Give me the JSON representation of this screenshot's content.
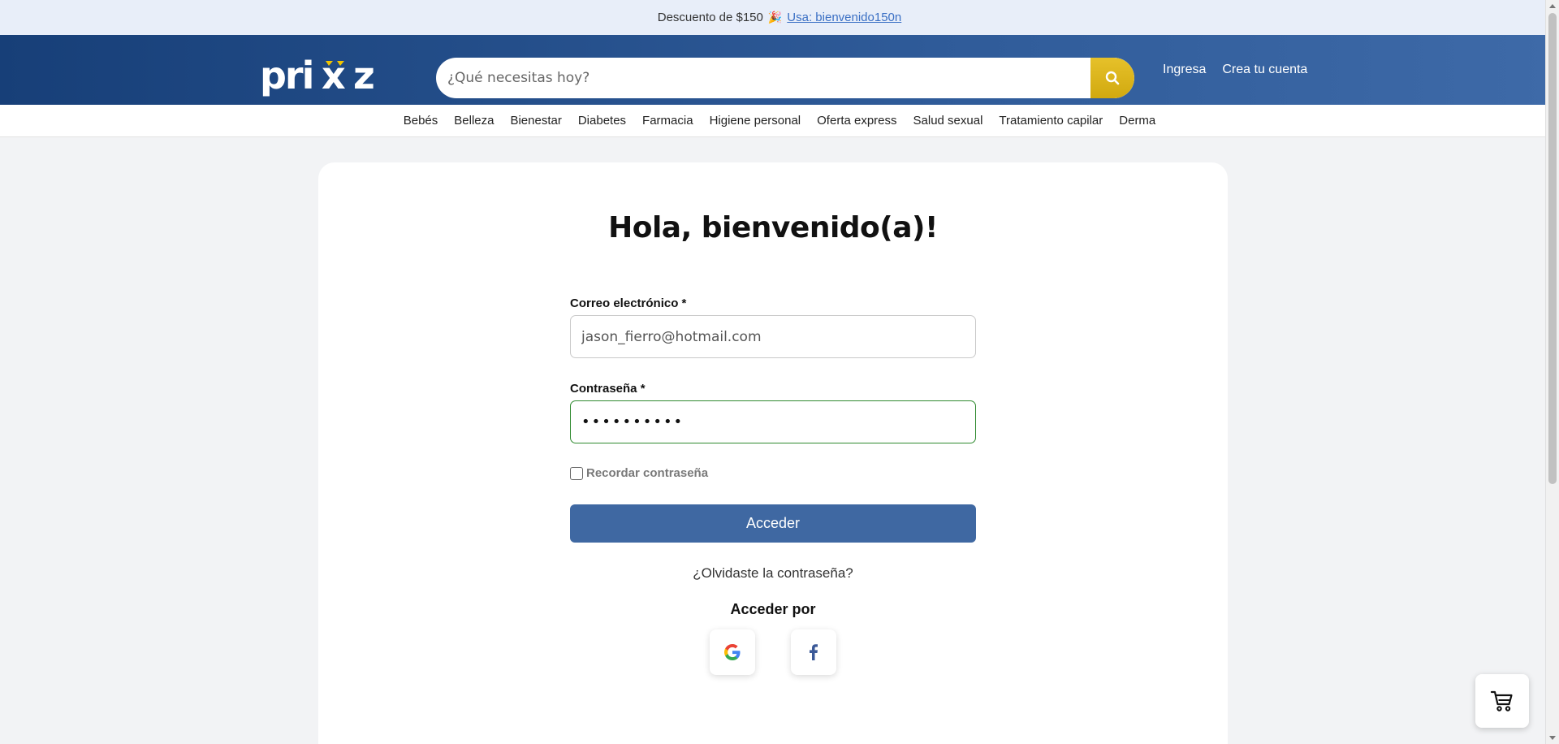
{
  "promo": {
    "text": "Descuento de $150",
    "confetti_icon": "party-popper-icon",
    "code_link": "Usa: bienvenido150n"
  },
  "header": {
    "logo_text": "prixz",
    "search_placeholder": "¿Qué necesitas hoy?",
    "login_link": "Ingresa",
    "register_link": "Crea tu cuenta"
  },
  "nav": {
    "items": [
      "Bebés",
      "Belleza",
      "Bienestar",
      "Diabetes",
      "Farmacia",
      "Higiene personal",
      "Oferta express",
      "Salud sexual",
      "Tratamiento capilar",
      "Derma"
    ]
  },
  "login": {
    "title": "Hola, bienvenido(a)!",
    "email_label": "Correo electrónico *",
    "email_value": "jason_fierro@hotmail.com",
    "password_label": "Contraseña *",
    "password_value": "••••••••••",
    "remember_label": "Recordar contraseña",
    "submit_label": "Acceder",
    "forgot_link": "¿Olvidaste la contraseña?",
    "social_title": "Acceder por"
  },
  "colors": {
    "header_dark": "#173f78",
    "header_light": "#3e6aa8",
    "search_button": "#dcb51c",
    "submit_button": "#3f68a2",
    "focus_border": "#2f8a2f",
    "logo_accent": "#f2c500"
  }
}
